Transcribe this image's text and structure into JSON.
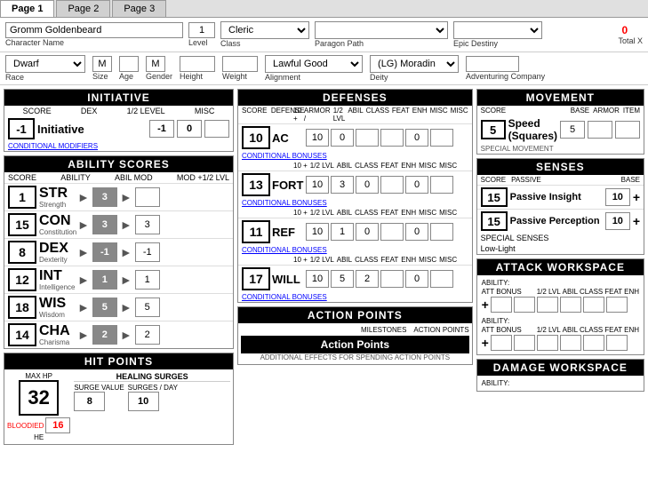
{
  "tabs": [
    {
      "label": "Page 1",
      "active": true
    },
    {
      "label": "Page 2",
      "active": false
    },
    {
      "label": "Page 3",
      "active": false
    }
  ],
  "header": {
    "char_name": "Gromm Goldenbeard",
    "char_name_label": "Character Name",
    "level": "1",
    "level_label": "Level",
    "class_label": "Class",
    "class_value": "Cleric",
    "paragon_label": "Paragon Path",
    "paragon_value": "",
    "epic_label": "Epic Destiny",
    "epic_value": "",
    "total_xp_label": "Total X",
    "total_xp_value": "0"
  },
  "race_row": {
    "race_label": "Race",
    "race_value": "Dwarf",
    "size_label": "Size",
    "size_value": "M",
    "age_label": "Age",
    "age_value": "",
    "gender_label": "Gender",
    "gender_value": "M",
    "height_label": "Height",
    "height_value": "",
    "weight_label": "Weight",
    "weight_value": "",
    "alignment_label": "Alignment",
    "alignment_value": "Lawful Good",
    "deity_label": "Deity",
    "deity_value": "(LG) Moradin",
    "company_label": "Adventuring Company",
    "company_value": ""
  },
  "initiative": {
    "section_title": "INITIATIVE",
    "score_label": "SCORE",
    "dex_label": "DEX",
    "half_lvl_label": "1/2 LEVEL",
    "misc_label": "MISC",
    "score_value": "-1",
    "name": "Initiative",
    "dex_value": "-1",
    "half_lvl_value": "0",
    "misc_value": "",
    "cond_mod": "CONDITIONAL MODIFIERS"
  },
  "ability_scores": {
    "section_title": "ABILITY SCORES",
    "headers": [
      "SCORE",
      "ABILITY",
      "ABIL MOD",
      "MOD +1/2 LVL"
    ],
    "abilities": [
      {
        "abbr": "STR",
        "full": "Strength",
        "score": "1",
        "mod": "3",
        "mod_half": ""
      },
      {
        "abbr": "CON",
        "full": "Constitution",
        "score": "15",
        "mod": "3",
        "mod_half": "3"
      },
      {
        "abbr": "DEX",
        "full": "Dexterity",
        "score": "8",
        "mod": "-1",
        "mod_half": "-1"
      },
      {
        "abbr": "INT",
        "full": "Intelligence",
        "score": "12",
        "mod": "1",
        "mod_half": "1"
      },
      {
        "abbr": "WIS",
        "full": "Wisdom",
        "score": "18",
        "mod": "5",
        "mod_half": "5"
      },
      {
        "abbr": "CHA",
        "full": "Charisma",
        "score": "14",
        "mod": "2",
        "mod_half": "2"
      }
    ]
  },
  "hit_points": {
    "section_title": "HIT POINTS",
    "max_hp_label": "MAX HP",
    "hp_value": "32",
    "bloodied_label": "BLOODIED",
    "bloodied_value": "16",
    "surge_section": "HEALING SURGES",
    "surge_value_label": "SURGE VALUE",
    "surge_value": "8",
    "surges_day_label": "SURGES / DAY",
    "surges_day_value": "10",
    "hp_note": "HE"
  },
  "defenses": {
    "section_title": "DEFENSES",
    "items": [
      {
        "defense": "AC",
        "ten_plus": "10 +",
        "armor_label": "ARMOR /",
        "lvl_label": "1/2 LVL",
        "abil_label": "ABIL",
        "class_label": "CLASS",
        "feat_label": "FEAT",
        "enh_label": "ENH",
        "misc1": "MISC",
        "misc2": "MISC",
        "score": "10",
        "vals": [
          "10",
          "0",
          "",
          "",
          "0",
          ""
        ]
      },
      {
        "defense": "FORT",
        "ten_plus": "10 +",
        "score": "13",
        "vals": [
          "10",
          "3",
          "0",
          "",
          "0",
          ""
        ]
      },
      {
        "defense": "REF",
        "ten_plus": "10 +",
        "score": "11",
        "vals": [
          "10",
          "1",
          "0",
          "",
          "0",
          ""
        ]
      },
      {
        "defense": "WILL",
        "ten_plus": "10 +",
        "score": "17",
        "vals": [
          "10",
          "5",
          "2",
          "",
          "0",
          ""
        ]
      }
    ],
    "cond_bonus": "CONDITIONAL BONUSES"
  },
  "action_points": {
    "section_title": "ACTION POINTS",
    "milestones_label": "MILESTONES",
    "action_points_label": "ACTION POINTS",
    "button_label": "Action Points",
    "note": "ADDITIONAL EFFECTS FOR SPENDING ACTION POINTS"
  },
  "movement": {
    "section_title": "MOVEMENT",
    "score_label": "SCORE",
    "base_label": "BASE",
    "armor_label": "ARMOR",
    "item_label": "ITEM",
    "speed_label": "Speed (Squares)",
    "speed_score": "5",
    "speed_base": "5",
    "special_label": "SPECIAL MOVEMENT"
  },
  "senses": {
    "section_title": "SENSES",
    "score_label": "SCORE",
    "passive_label": "PASSIVE",
    "base_label": "BASE",
    "items": [
      {
        "name": "Passive Insight",
        "score": "15",
        "base": "10",
        "extra": "+"
      },
      {
        "name": "Passive Perception",
        "score": "15",
        "base": "10",
        "extra": "+"
      }
    ],
    "special_label": "SPECIAL SENSES",
    "special_value": "Low-Light"
  },
  "attack_workspace": {
    "section_title": "ATTACK WORKSPACE",
    "ability_label": "ABILITY:",
    "att_bonus_label": "ATT BONUS",
    "half_lvl": "1/2 LVL",
    "abil": "ABIL",
    "class": "CLASS",
    "feat": "FEAT",
    "enh": "ENH",
    "plus": "+",
    "ability2_label": "ABILITY:",
    "plus2": "+"
  },
  "damage_workspace": {
    "section_title": "DAMAGE WORKSPACE",
    "ability_label": "ABILITY:"
  }
}
